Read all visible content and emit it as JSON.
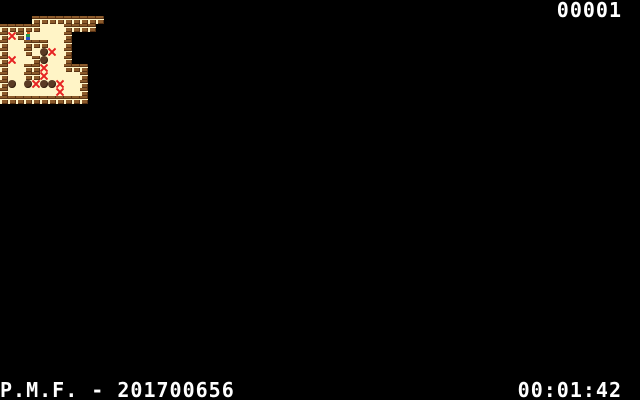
{
  "hud": {
    "moves": "00001",
    "footer": "P.M.F. - 201700656",
    "timer": "00:01:42"
  },
  "colors": {
    "background": "#000000",
    "floor": "#fff4c6",
    "wall": "#8b5a2b",
    "box": "#5a3a24",
    "target": "#e62222",
    "hud_text": "#ffffff"
  },
  "board": {
    "legend": {
      "#": "wall",
      ".": "target",
      "$": "box",
      "*": "box-on-target",
      "@": "player",
      " ": "floor",
      "_": "empty"
    },
    "rows": [
      "____#########___",
      "#####   ####____",
      "#.#@    #_______",
      "#  ###  #_______",
      "#  # $. #_______",
      "#.  #$  #_______",
      "#  ##.  ###_____",
      "#  ##.    #_____",
      "#$ $.$$.  #_____",
      "#      .  #_____",
      "###########_____"
    ]
  }
}
